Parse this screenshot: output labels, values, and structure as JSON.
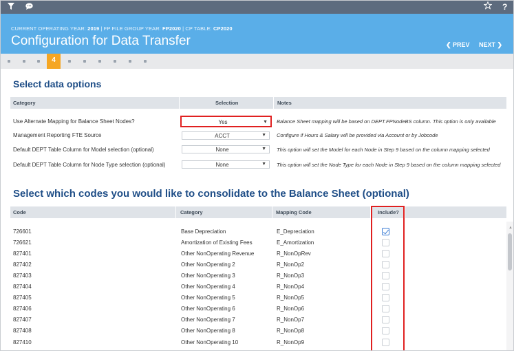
{
  "topbar": {
    "filter_icon": "filter-icon",
    "chat_icon": "chat-icon",
    "star_icon": "star-icon",
    "help_label": "?"
  },
  "header": {
    "meta_prefix_1": "CURRENT OPERATING YEAR: ",
    "operating_year": "2019",
    "meta_prefix_2": " | FP FILE GROUP YEAR: ",
    "file_group_year": "FP2020",
    "meta_prefix_3": " | CP TABLE: ",
    "cp_table": "CP2020",
    "title": "Configuration for Data Transfer",
    "prev_label": "❮ PREV",
    "next_label": "NEXT ❯"
  },
  "steps": {
    "active_label": "4"
  },
  "data_options": {
    "title": "Select data options",
    "headers": {
      "category": "Category",
      "selection": "Selection",
      "notes": "Notes"
    },
    "rows": [
      {
        "category": "Use Alternate Mapping for Balance Sheet Nodes?",
        "selection": "Yes",
        "note": "Balance Sheet mapping will be based on DEPT.FPNodeBS column. This option is only available"
      },
      {
        "category": "Management Reporting FTE Source",
        "selection": "ACCT",
        "note": "Configure if Hours & Salary will be provided via Account or by Jobcode"
      },
      {
        "category": "Default DEPT Table Column for Model selection (optional)",
        "selection": "None",
        "note": "This option will set the Model for each Node in Step 9 based on the column mapping selected"
      },
      {
        "category": "Default DEPT Table Column for Node Type selection (optional)",
        "selection": "None",
        "note": "This option will set the Node Type for each Node in Step 9 based on the column mapping selected"
      }
    ]
  },
  "consolidate": {
    "title": "Select which codes you would like to consolidate to the Balance Sheet (optional)",
    "headers": {
      "code": "Code",
      "category": "Category",
      "mapping": "Mapping Code",
      "include": "Include?"
    },
    "rows": [
      {
        "code": "726601",
        "category": "Base Depreciation",
        "mapping": "E_Depreciation",
        "checked": true
      },
      {
        "code": "726621",
        "category": "Amortization of Existing Fees",
        "mapping": "E_Amortization",
        "checked": false
      },
      {
        "code": "827401",
        "category": "Other NonOperating Revenue",
        "mapping": "R_NonOpRev",
        "checked": false
      },
      {
        "code": "827402",
        "category": "Other NonOperating 2",
        "mapping": "R_NonOp2",
        "checked": false
      },
      {
        "code": "827403",
        "category": "Other NonOperating 3",
        "mapping": "R_NonOp3",
        "checked": false
      },
      {
        "code": "827404",
        "category": "Other NonOperating 4",
        "mapping": "R_NonOp4",
        "checked": false
      },
      {
        "code": "827405",
        "category": "Other NonOperating 5",
        "mapping": "R_NonOp5",
        "checked": false
      },
      {
        "code": "827406",
        "category": "Other NonOperating 6",
        "mapping": "R_NonOp6",
        "checked": false
      },
      {
        "code": "827407",
        "category": "Other NonOperating 7",
        "mapping": "R_NonOp7",
        "checked": false
      },
      {
        "code": "827408",
        "category": "Other NonOperating 8",
        "mapping": "R_NonOp8",
        "checked": false
      },
      {
        "code": "827410",
        "category": "Other NonOperating 10",
        "mapping": "R_NonOp9",
        "checked": false
      }
    ]
  },
  "colors": {
    "header_bg": "#5aaee8",
    "topbar_bg": "#5d6b7e",
    "step_active": "#f5a623",
    "title_text": "#1f4e87",
    "highlight": "#e02020"
  }
}
